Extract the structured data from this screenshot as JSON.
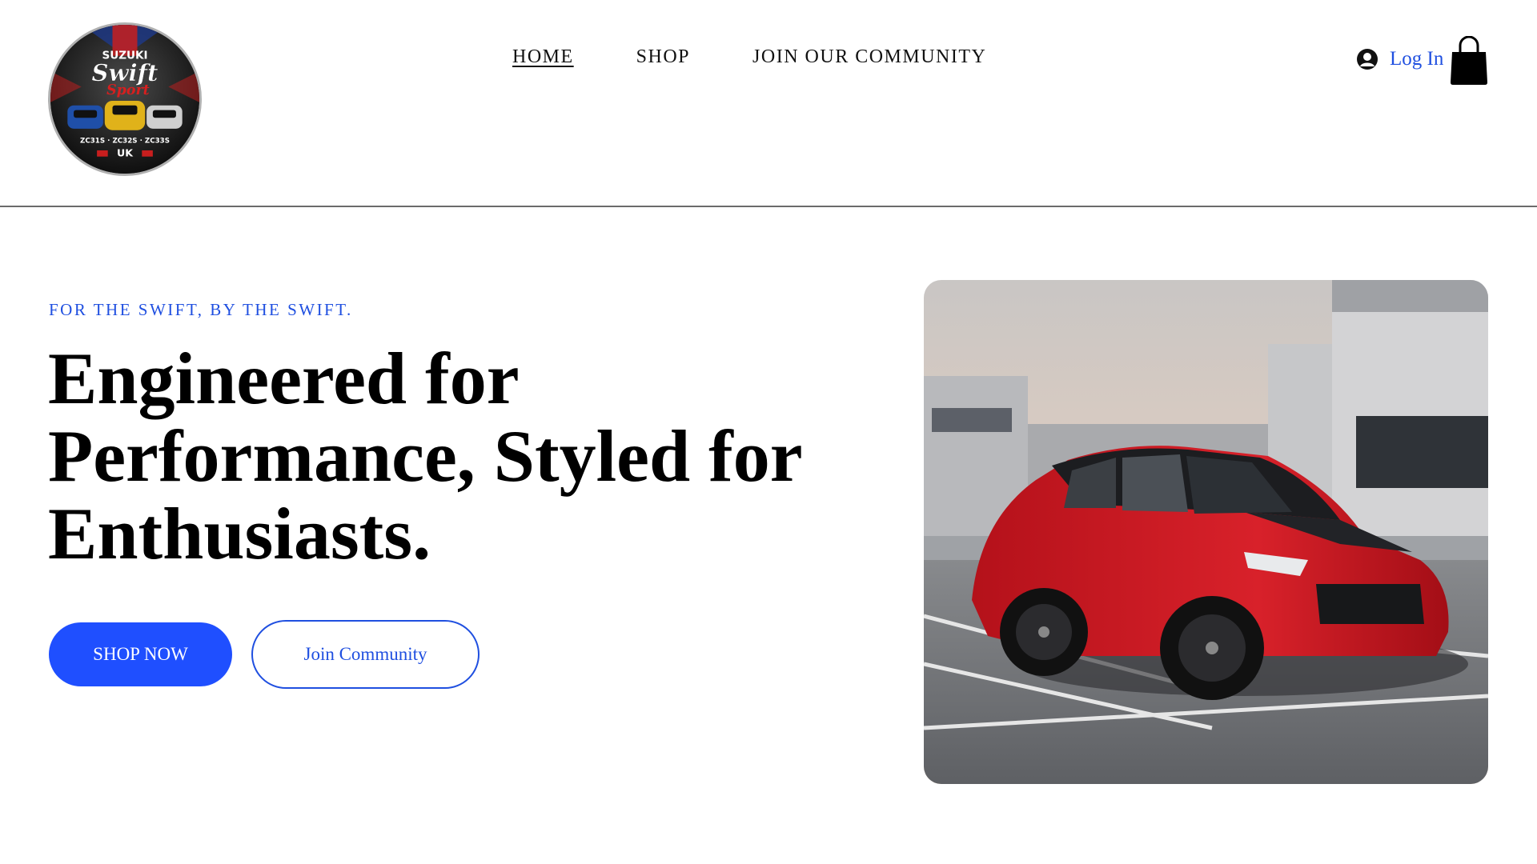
{
  "header": {
    "logo": {
      "brand": "SUZUKI",
      "wordmark": "Swift",
      "subword": "Sport",
      "models": "ZC31S · ZC32S · ZC33S",
      "region": "UK"
    },
    "nav": [
      {
        "label": "HOME",
        "active": true
      },
      {
        "label": "SHOP",
        "active": false
      },
      {
        "label": "JOIN OUR COMMUNITY",
        "active": false
      }
    ],
    "login_label": "Log In",
    "user_icon": "user-circle-icon",
    "cart_icon": "shopping-bag-icon"
  },
  "hero": {
    "eyebrow": "FOR THE SWIFT, BY THE SWIFT.",
    "headline_line1": "Engineered for",
    "headline_line2": "Performance, Styled for",
    "headline_line3": "Enthusiasts.",
    "primary_button": "SHOP NOW",
    "secondary_button": "Join Community"
  },
  "colors": {
    "accent": "#1f4fff",
    "link": "#1f4fe0",
    "text": "#000000",
    "divider": "#6b6b6b"
  }
}
